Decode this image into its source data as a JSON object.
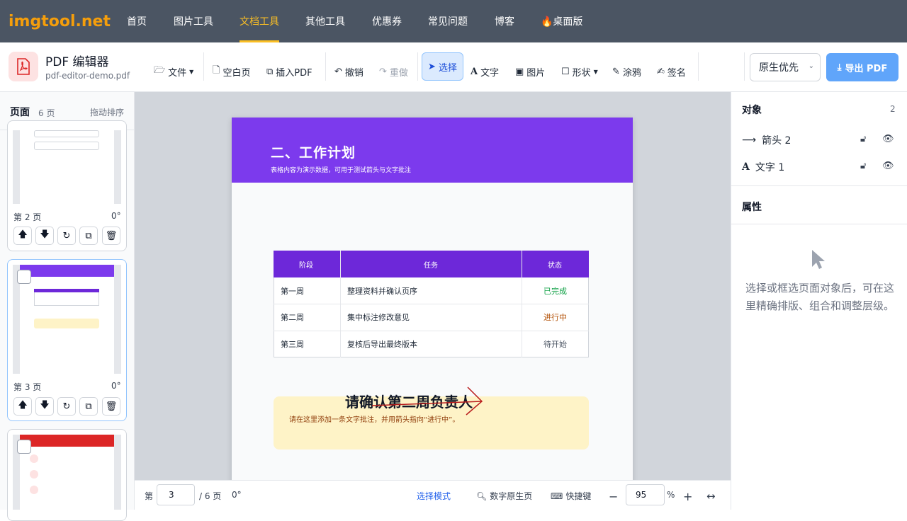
{
  "nav": {
    "logo": "imgtool.net",
    "items": [
      "首页",
      "图片工具",
      "文档工具",
      "其他工具",
      "优惠券",
      "常见问题",
      "博客",
      "🔥桌面版"
    ],
    "active_index": 2
  },
  "app": {
    "title": "PDF 编辑器",
    "filename": "pdf-editor-demo.pdf"
  },
  "toolbar": {
    "file": "文件",
    "blank_page": "空白页",
    "insert_pdf": "插入PDF",
    "undo": "撤销",
    "redo": "重做",
    "select": "选择",
    "text": "文字",
    "image": "图片",
    "shape": "形状",
    "draw": "涂鸦",
    "sign": "签名",
    "mode_select": "原生优先",
    "export": "导出 PDF"
  },
  "sidebar": {
    "title": "页面",
    "count": "6 页",
    "sort": "拖动排序",
    "pages": [
      {
        "label": "第 2 页",
        "rotation": "0°"
      },
      {
        "label": "第 3 页",
        "rotation": "0°"
      },
      {
        "label": "",
        "rotation": ""
      }
    ]
  },
  "document": {
    "title": "二、工作计划",
    "subtitle": "表格内容为演示数据，可用于测试箭头与文字批注",
    "table": {
      "headers": [
        "阶段",
        "任务",
        "状态"
      ],
      "rows": [
        [
          "第一周",
          "整理资料并确认页序",
          "已完成"
        ],
        [
          "第二周",
          "集中标注修改意见",
          "进行中"
        ],
        [
          "第三周",
          "复核后导出最终版本",
          "待开始"
        ]
      ],
      "status_colors": [
        "#16a34a",
        "#b45309",
        "#4b5563"
      ]
    },
    "note": "请在这里添加一条文字批注，并用箭头指向“进行中”。",
    "overlay_text": "请确认第二周负责人"
  },
  "statusbar": {
    "page_prefix": "第",
    "page_value": "3",
    "page_total": "/ 6 页",
    "rotation": "0°",
    "mode": "选择模式",
    "digital": "数字原生页",
    "shortcuts": "快捷键",
    "zoom": "95",
    "zoom_unit": "%"
  },
  "right_panel": {
    "objects_title": "对象",
    "objects_count": "2",
    "objects": [
      {
        "name": "箭头 2",
        "icon": "arrow-icon"
      },
      {
        "name": "文字 1",
        "icon": "text-icon"
      }
    ],
    "props_title": "属性",
    "hint": "选择或框选页面对象后，可在这里精确排版、组合和调整层级。"
  },
  "colors": {
    "nav_bg": "#4b5563",
    "accent": "#fbbf24",
    "header_purple": "#7c3aed",
    "export_blue": "#60a5fa"
  }
}
